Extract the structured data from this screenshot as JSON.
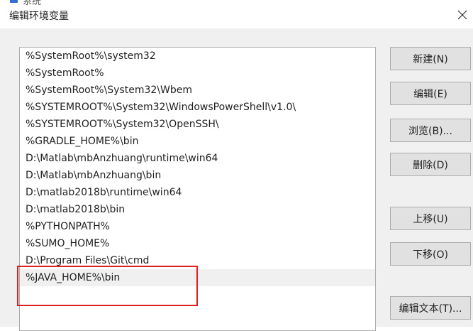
{
  "window": {
    "title": "编辑环境变量",
    "clipped_text": "系统"
  },
  "list": {
    "items": [
      "%SystemRoot%\\system32",
      "%SystemRoot%",
      "%SystemRoot%\\System32\\Wbem",
      "%SYSTEMROOT%\\System32\\WindowsPowerShell\\v1.0\\",
      "%SYSTEMROOT%\\System32\\OpenSSH\\",
      "%GRADLE_HOME%\\bin",
      "D:\\Matlab\\mbAnzhuang\\runtime\\win64",
      "D:\\Matlab\\mbAnzhuang\\bin",
      "D:\\matlab2018b\\runtime\\win64",
      "D:\\matlab2018b\\bin",
      "%PYTHONPATH%",
      "%SUMO_HOME%",
      "D:\\Program Files\\Git\\cmd",
      "%JAVA_HOME%\\bin",
      ""
    ],
    "selected_index": 13
  },
  "buttons": {
    "new": "新建(N)",
    "edit": "编辑(E)",
    "browse": "浏览(B)...",
    "delete": "删除(D)",
    "move_up": "上移(U)",
    "move_down": "下移(O)",
    "edit_text": "编辑文本(T)..."
  },
  "colors": {
    "highlight_box": "#e02020",
    "dialog_background": "#f0f0f0"
  }
}
